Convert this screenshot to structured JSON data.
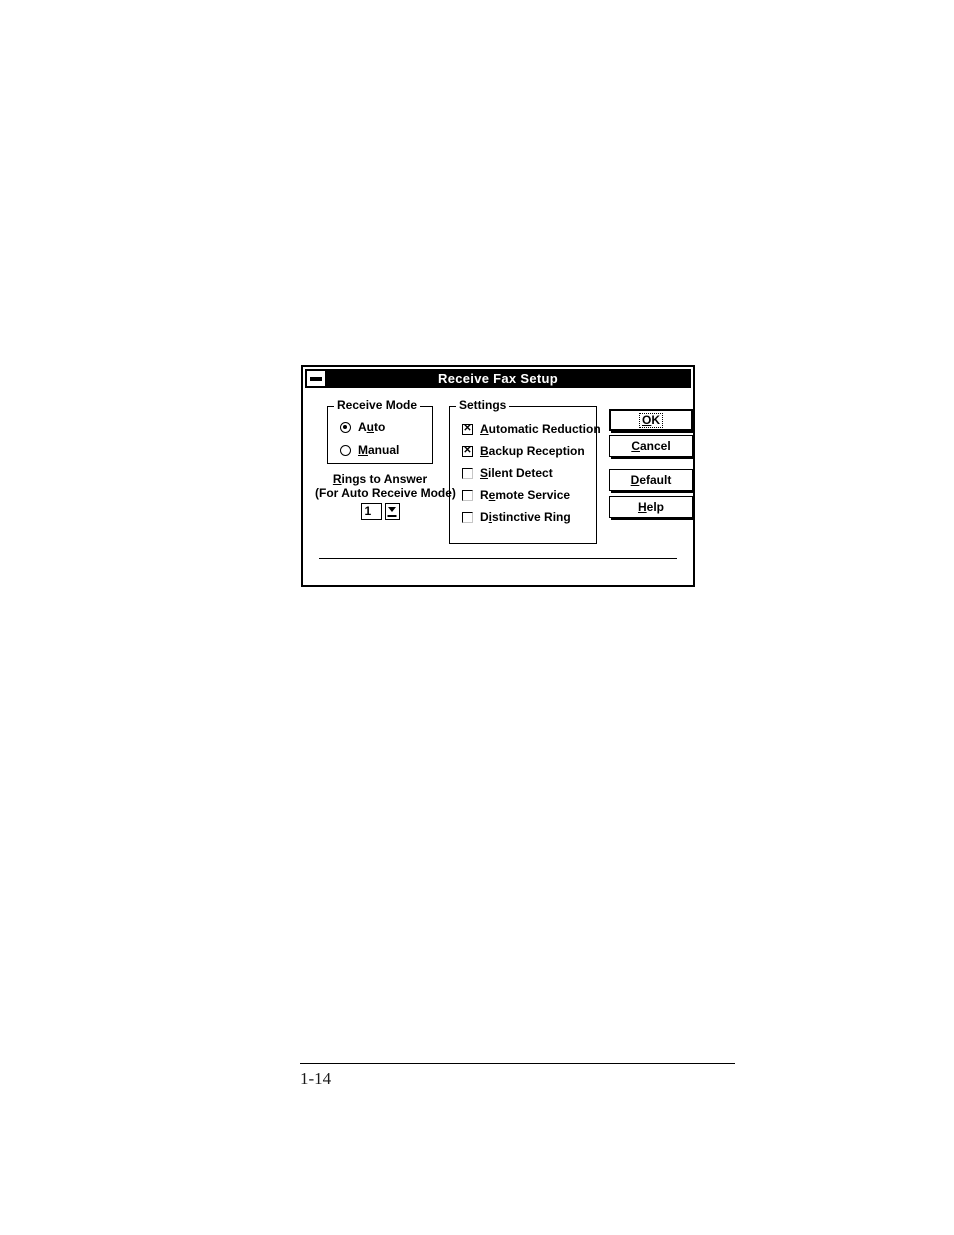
{
  "page": {
    "footer_rule": "horizontal-rule",
    "page_number": "1-14"
  },
  "dialog": {
    "title": "Receive Fax Setup",
    "control_menu_icon": "control-menu-box",
    "receive_mode": {
      "group_title": "Receive Mode",
      "options": [
        {
          "label": "Auto",
          "accel_before": "A",
          "accel": "u",
          "accel_after": "to",
          "selected": true
        },
        {
          "label": "Manual",
          "accel_before": "",
          "accel": "M",
          "accel_after": "anual",
          "selected": false
        }
      ],
      "selected_value": "Auto"
    },
    "rings": {
      "label_line1_before": "",
      "label_line1_accel": "R",
      "label_line1_after": "ings to Answer",
      "label_line2": "(For Auto Receive Mode)",
      "value": "1",
      "spinner_icon": "spinner-down-arrow-icon"
    },
    "settings": {
      "group_title": "Settings",
      "items": [
        {
          "before": "",
          "accel": "A",
          "after": "utomatic Reduction",
          "label": "Automatic Reduction",
          "checked": true
        },
        {
          "before": "",
          "accel": "B",
          "after": "ackup Reception",
          "label": "Backup Reception",
          "checked": true
        },
        {
          "before": "",
          "accel": "S",
          "after": "ilent Detect",
          "label": "Silent Detect",
          "checked": false
        },
        {
          "before": "R",
          "accel": "e",
          "after": "mote Service",
          "label": "Remote Service",
          "checked": false
        },
        {
          "before": "D",
          "accel": "i",
          "after": "stinctive Ring",
          "label": "Distinctive Ring",
          "checked": false
        }
      ]
    },
    "buttons": [
      {
        "before": "",
        "accel": "O",
        "after": "K",
        "label": "OK",
        "default": true
      },
      {
        "before": "",
        "accel": "C",
        "after": "ancel",
        "label": "Cancel",
        "default": false
      },
      {
        "before": "",
        "accel": "D",
        "after": "efault",
        "label": "Default",
        "default": false
      },
      {
        "before": "",
        "accel": "H",
        "after": "elp",
        "label": "Help",
        "default": false
      }
    ]
  },
  "colors": {
    "titlebar_background": "#000000",
    "titlebar_text": "#ffffff",
    "dialog_background": "#ffffff",
    "border": "#000000",
    "page_background": "#ffffff"
  }
}
